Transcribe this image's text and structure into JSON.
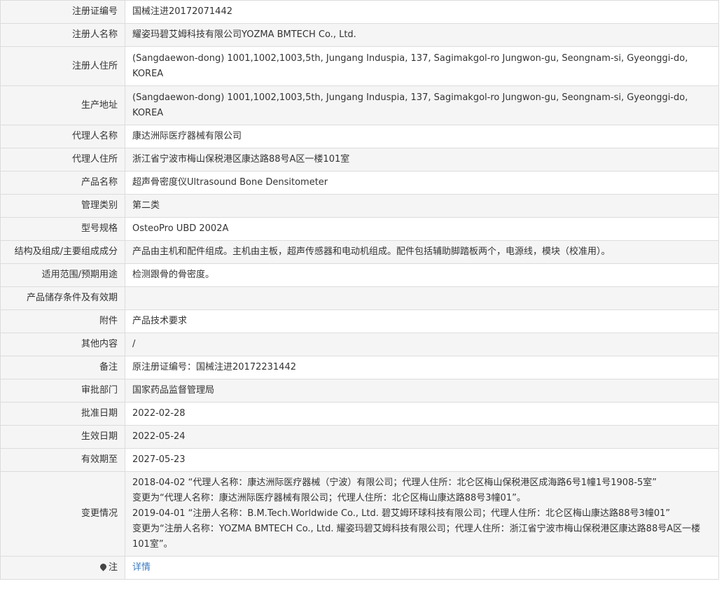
{
  "rows": [
    {
      "label": "注册证编号",
      "value": "国械注进20172071442"
    },
    {
      "label": "注册人名称",
      "value": "耀姿玛碧艾姆科技有限公司YOZMA BMTECH Co., Ltd."
    },
    {
      "label": "注册人住所",
      "value": "(Sangdaewon-dong) 1001,1002,1003,5th, Jungang Induspia, 137, Sagimakgol-ro Jungwon-gu, Seongnam-si, Gyeonggi-do, KOREA"
    },
    {
      "label": "生产地址",
      "value": "(Sangdaewon-dong) 1001,1002,1003,5th, Jungang Induspia, 137, Sagimakgol-ro Jungwon-gu, Seongnam-si, Gyeonggi-do, KOREA"
    },
    {
      "label": "代理人名称",
      "value": "康达洲际医疗器械有限公司"
    },
    {
      "label": "代理人住所",
      "value": "浙江省宁波市梅山保税港区康达路88号A区一楼101室"
    },
    {
      "label": "产品名称",
      "value": "超声骨密度仪Ultrasound Bone Densitometer"
    },
    {
      "label": "管理类别",
      "value": "第二类"
    },
    {
      "label": "型号规格",
      "value": "OsteoPro UBD 2002A"
    },
    {
      "label": "结构及组成/主要组成成分",
      "value": "产品由主机和配件组成。主机由主板，超声传感器和电动机组成。配件包括辅助脚踏板两个，电源线，模块（校准用）。"
    },
    {
      "label": "适用范围/预期用途",
      "value": "检测跟骨的骨密度。"
    },
    {
      "label": "产品储存条件及有效期",
      "value": ""
    },
    {
      "label": "附件",
      "value": "产品技术要求"
    },
    {
      "label": "其他内容",
      "value": "/"
    },
    {
      "label": "备注",
      "value": "原注册证编号：国械注进20172231442"
    },
    {
      "label": "审批部门",
      "value": "国家药品监督管理局"
    },
    {
      "label": "批准日期",
      "value": "2022-02-28"
    },
    {
      "label": "生效日期",
      "value": "2022-05-24"
    },
    {
      "label": "有效期至",
      "value": "2027-05-23"
    }
  ],
  "changes": {
    "label": "变更情况",
    "lines": [
      "2018-04-02 “代理人名称：康达洲际医疗器械（宁波）有限公司；代理人住所：北仑区梅山保税港区成海路6号1幢1号1908-5室”",
      "变更为“代理人名称：康达洲际医疗器械有限公司；代理人住所：北仑区梅山康达路88号3幢01”。",
      "2019-04-01 “注册人名称：B.M.Tech.Worldwide Co., Ltd. 碧艾姆环球科技有限公司；代理人住所：北仑区梅山康达路88号3幢01”",
      "变更为“注册人名称：YOZMA BMTECH Co., Ltd. 耀姿玛碧艾姆科技有限公司；代理人住所：浙江省宁波市梅山保税港区康达路88号A区一楼101室”。"
    ]
  },
  "note": {
    "icon": "pin-icon",
    "label": "注",
    "link_text": "详情",
    "link_color": "#3a7cc2"
  }
}
